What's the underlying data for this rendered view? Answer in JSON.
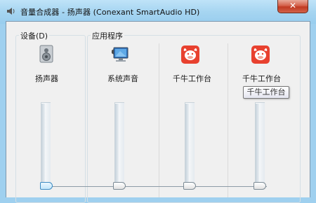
{
  "window": {
    "title": "音量合成器 - 扬声器 (Conexant SmartAudio HD)",
    "close_label": "✕"
  },
  "device_group": {
    "label": "设备(D)"
  },
  "apps_group": {
    "label": "应用程序"
  },
  "channels": [
    {
      "label": "扬声器",
      "icon": "speaker-icon",
      "volume": 0,
      "focused": true
    },
    {
      "label": "系统声音",
      "icon": "system-sounds-icon",
      "volume": 0,
      "focused": false
    },
    {
      "label": "千牛工作台",
      "icon": "qianniu-icon",
      "volume": 0,
      "focused": false
    },
    {
      "label": "千牛工作台",
      "icon": "qianniu-icon",
      "volume": 0,
      "focused": false
    }
  ],
  "tooltip": {
    "text": "千牛工作台"
  },
  "colors": {
    "qianniu_red": "#e8412f",
    "title_bar": "#a6d5f1",
    "thumb_focus": "#3c8ac2"
  }
}
